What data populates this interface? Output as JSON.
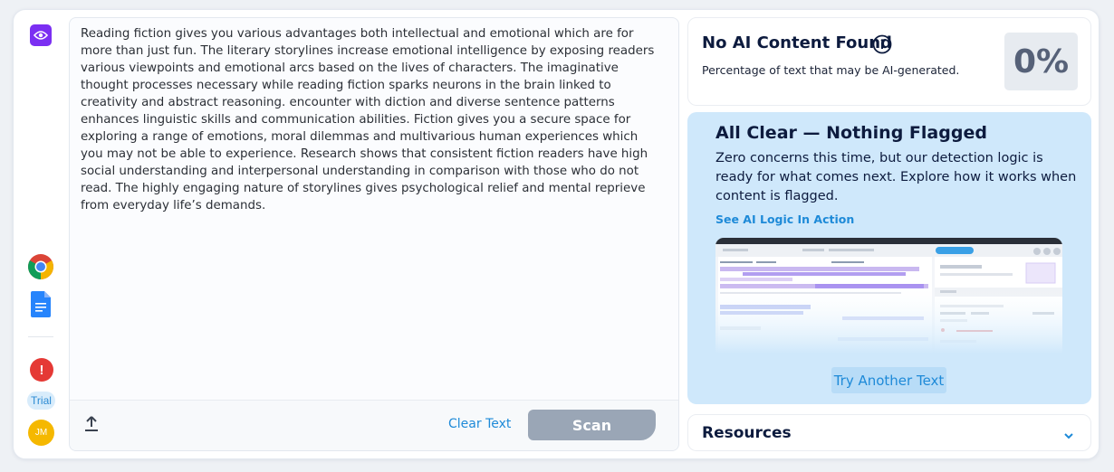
{
  "editor": {
    "text": "Reading fiction gives you various advantages both intellectual and emotional which are for more than just fun. The literary storylines increase emotional intelligence by exposing readers various viewpoints and emotional arcs based on the lives of characters. The imaginative thought processes necessary while reading fiction sparks neurons in the brain linked to creativity and abstract reasoning. encounter with diction and diverse sentence patterns enhances linguistic skills and communication abilities. Fiction gives you a secure space for exploring a range of emotions, moral dilemmas and multivarious human experiences which you may not be able to experience. Research shows that consistent fiction readers have high social understanding and interpersonal understanding in comparison with those who do not read. The highly engaging nature of storylines gives psychological relief and mental reprieve from everyday life’s demands.",
    "clear_label": "Clear Text",
    "scan_label": "Scan"
  },
  "sidebar": {
    "trial_label": "Trial",
    "avatar_initials": "JM",
    "alert_glyph": "!"
  },
  "result": {
    "title": "No AI Content Found",
    "subtitle": "Percentage of text that may be AI-generated.",
    "percentage": "0%"
  },
  "clear_panel": {
    "title": "All Clear — Nothing Flagged",
    "body": "Zero concerns this time, but our detection logic is ready for what comes next. Explore how it works when content is flagged.",
    "link": "See AI Logic In Action",
    "try_label": "Try Another Text"
  },
  "resources": {
    "title": "Resources"
  },
  "colors": {
    "accent": "#1e8ad8",
    "brand_purple": "#7b2ff2",
    "panel_blue": "#cfe8fb",
    "scan_disabled": "#9aa6b6"
  }
}
